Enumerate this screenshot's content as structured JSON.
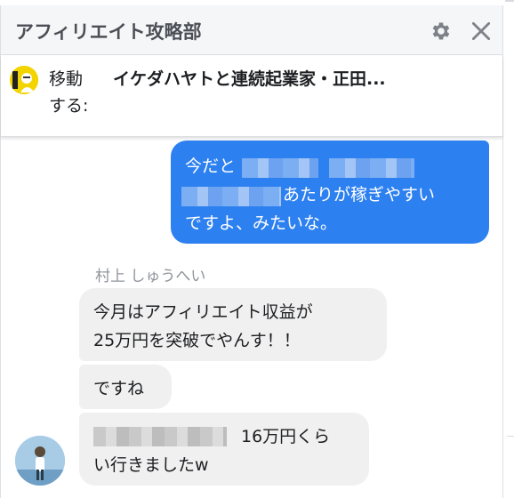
{
  "header": {
    "title": "アフィリエイト攻略部",
    "settings_icon": "gear-icon",
    "close_icon": "close-icon"
  },
  "move_bar": {
    "label_line1": "移動",
    "label_line2": "する:",
    "target": "イケダハヤトと連続起業家・正田..."
  },
  "messages": {
    "outgoing": {
      "line1_prefix": "今だと",
      "line2_suffix": "あたりが稼ぎやすい",
      "line3": "ですよ、みたいな。"
    },
    "sender_name": "村上 しゅうへい",
    "incoming": [
      {
        "line1": "今月はアフィリエイト収益が",
        "line2": "25万円を突破でやんす！！"
      },
      {
        "line1": "ですね"
      },
      {
        "line1_suffix": "16万円くら",
        "line2": "い行きましたw"
      }
    ]
  },
  "colors": {
    "outgoing_bubble": "#2d80f0",
    "incoming_bubble": "#f1f0f0",
    "header_bg": "#f5f6f7"
  }
}
